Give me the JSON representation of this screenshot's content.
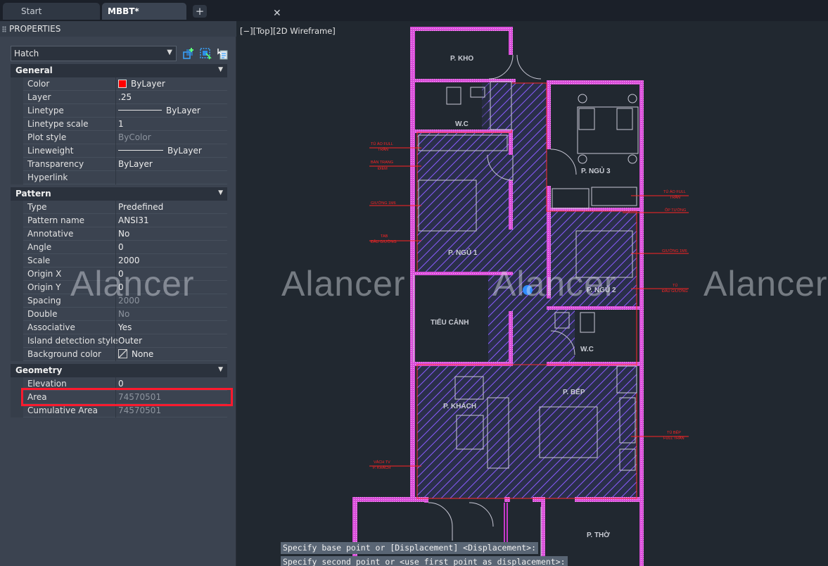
{
  "tabs": [
    {
      "label": "Start"
    },
    {
      "label": "MBBT*",
      "active": true,
      "close_glyph": "✕"
    }
  ],
  "add_tab_glyph": "+",
  "panel": {
    "title": "PROPERTIES",
    "object_type": "Hatch",
    "tool_icons": [
      "quick-select-icon",
      "select-objects-icon",
      "toggle-pickadd-icon"
    ]
  },
  "sections": {
    "general": {
      "label": "General",
      "rows": [
        {
          "key": "Color",
          "value": "ByLayer"
        },
        {
          "key": "Layer",
          "value": ".25"
        },
        {
          "key": "Linetype",
          "value": "ByLayer"
        },
        {
          "key": "Linetype scale",
          "value": "1"
        },
        {
          "key": "Plot style",
          "value": "ByColor"
        },
        {
          "key": "Lineweight",
          "value": "ByLayer"
        },
        {
          "key": "Transparency",
          "value": "ByLayer"
        },
        {
          "key": "Hyperlink",
          "value": ""
        }
      ]
    },
    "pattern": {
      "label": "Pattern",
      "rows": [
        {
          "key": "Type",
          "value": "Predefined"
        },
        {
          "key": "Pattern name",
          "value": "ANSI31"
        },
        {
          "key": "Annotative",
          "value": "No"
        },
        {
          "key": "Angle",
          "value": "0"
        },
        {
          "key": "Scale",
          "value": "2000"
        },
        {
          "key": "Origin X",
          "value": "0"
        },
        {
          "key": "Origin Y",
          "value": "0"
        },
        {
          "key": "Spacing",
          "value": "2000"
        },
        {
          "key": "Double",
          "value": "No"
        },
        {
          "key": "Associative",
          "value": "Yes"
        },
        {
          "key": "Island detection style",
          "value": "Outer"
        },
        {
          "key": "Background color",
          "value": "None"
        }
      ]
    },
    "geometry": {
      "label": "Geometry",
      "rows": [
        {
          "key": "Elevation",
          "value": "0"
        },
        {
          "key": "Area",
          "value": "74570501"
        },
        {
          "key": "Cumulative Area",
          "value": "74570501"
        }
      ]
    }
  },
  "viewport": {
    "label": "[−][Top][2D Wireframe]",
    "rooms": [
      "P. KHO",
      "W.C",
      "P. NGỦ 3",
      "P. NGỦ 1",
      "TIỂU CẢNH",
      "P. NGỦ 2",
      "W.C",
      "P. KHÁCH",
      "P. BẾP",
      "P. THỜ"
    ],
    "annotations_left": [
      "TỦ ÁO FULL",
      "TRẦN",
      "BÀN TRANG",
      "ĐIỂM",
      "GIƯỜNG 1M6",
      "TAB",
      "ĐẦU GIƯỜNG",
      "VÁCH TV",
      "P. KHÁCH"
    ],
    "annotations_right": [
      "TỦ ÁO FULL",
      "TRẦN",
      "ÔP TƯỜNG",
      "GIƯỜNG 1M6",
      "TỦ",
      "ĐẦU GIƯỜNG",
      "TỦ BẾP",
      "FULL TRẦN"
    ]
  },
  "command_lines": [
    "Specify base point or [Displacement] <Displacement>:",
    "Specify second point or <use first point as displacement>:"
  ],
  "watermark": "Alancer",
  "colors": {
    "accent_highlight": "#ff1a2e",
    "hatch": "#8f5cff",
    "wall": "#e04ee0",
    "annotation": "#ff2424"
  }
}
